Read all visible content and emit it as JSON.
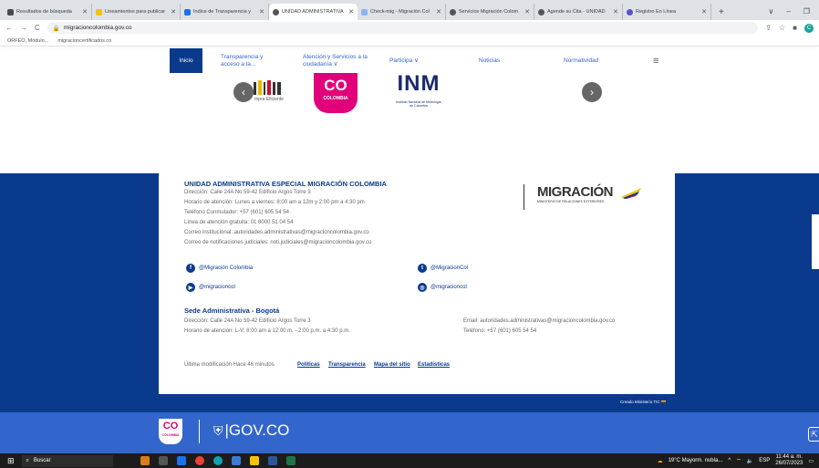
{
  "browser": {
    "tabs": [
      {
        "label": "Resultados de búsqueda",
        "color": "#4a4a4a"
      },
      {
        "label": "Lineamientos para publicar",
        "color": "#f4c20d"
      },
      {
        "label": "Índice de Transparencia y",
        "color": "#1a73e8"
      },
      {
        "label": "UNIDAD ADMINISTRATIVA",
        "color": "#555555",
        "active": true
      },
      {
        "label": "Check-mig - Migración Col",
        "color": "#8ab4f8"
      },
      {
        "label": "Servicios Migración Colom",
        "color": "#555555"
      },
      {
        "label": "Agende su Cita - UNIDAD",
        "color": "#555555"
      },
      {
        "label": "Registro En Línea",
        "color": "#5a4fcf"
      }
    ],
    "url": "migracioncolombia.gov.co",
    "bookmarks": [
      "ORFEO, Módulo...",
      "migracioncertificados.co"
    ]
  },
  "nav": {
    "inicio": "Inicio",
    "transparencia_1": "Transparencia y",
    "transparencia_2": "acceso a la...",
    "atencion_1": "Atención y Servicios a la",
    "atencion_2": "ciudadanía ∨",
    "participa": "Participa ∨",
    "noticias": "Noticias",
    "normatividad": "Normatividad"
  },
  "logos": {
    "compra_eficiente": "mpra Eficiente",
    "co_top": "CO",
    "co_bottom": "COLOMBIA",
    "inm": "INM",
    "inm_sub_1": "Instituto Nacional de Metrología",
    "inm_sub_2": "de Colombia"
  },
  "footer": {
    "entity": "UNIDAD ADMINISTRATIVA ESPECIAL MIGRACIÓN COLOMBIA",
    "lines": [
      "Dirección: Calle 24A No 59-42 Edificio Argos Torre 3",
      "Horario de atención: Lunes a viernes: 8:00 am a 12m y 2:00 pm a 4:30 pm",
      "Teléfono Conmutador: +57 (601) 605 54 54",
      "Línea de atención gratuita: 01 8000 51 04 54",
      "Correo institucional: autoridades.administrativas@migracioncolombia.gov.co",
      "Correo de notificaciones judiciales: noti.judiciales@migracioncolombia.gov.co"
    ],
    "logo_title": "MIGRACIÓN",
    "logo_sub": "MINISTERIO DE RELACIONES EXTERIORES",
    "social": {
      "facebook": "@Migración Colombia",
      "twitter": "@MigracionCol",
      "youtube": "@migracioncol",
      "instagram": "@migracioncol"
    },
    "sede_title": "Sede Administrativa - Bogotá",
    "sede_address": "Dirección: Calle 24A No 59-42 Edificio Argos Torre 3",
    "sede_hours": "Horario de atención: L-V: 8:00 am a 12:00 m. - 2:00 p.m. a 4:30 p.m.",
    "sede_email": "Email: autoridades.administrativas@migracioncolombia.gov.co",
    "sede_phone": "Teléfono: +57 (601) 605 54 54",
    "last_mod": "Última modificación Hace 46 minutos",
    "links": [
      "Políticas",
      "Transparencia",
      "Mapa del sitio",
      "Estadísticas"
    ],
    "credit": "Creado Ministerio TIC"
  },
  "gov": {
    "co_top": "CO",
    "co_bottom": "COLOMBIA",
    "brand": "|GOV.CO"
  },
  "taskbar": {
    "search": "Buscar",
    "weather": "19°C Mayorm. nubla...",
    "lang": "ESP",
    "time": "11:44 a. m.",
    "date": "26/07/2023"
  },
  "colors": {
    "primary": "#0a3a8c",
    "gov_blue": "#3366cc"
  }
}
